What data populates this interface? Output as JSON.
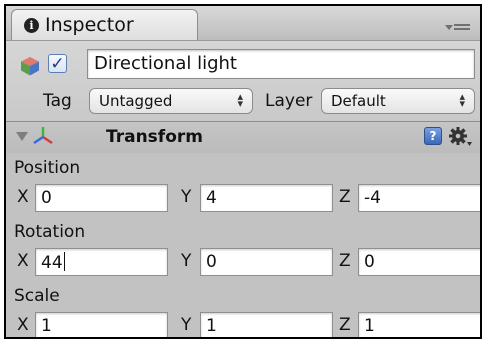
{
  "tab": {
    "title": "Inspector",
    "icon": "info-icon"
  },
  "object": {
    "active_checked": true,
    "name": "Directional light"
  },
  "tag": {
    "label": "Tag",
    "value": "Untagged"
  },
  "layer": {
    "label": "Layer",
    "value": "Default"
  },
  "component": {
    "title": "Transform",
    "expanded": true
  },
  "position": {
    "label": "Position",
    "x_label": "X",
    "x": "0",
    "y_label": "Y",
    "y": "4",
    "z_label": "Z",
    "z": "-4"
  },
  "rotation": {
    "label": "Rotation",
    "x_label": "X",
    "x": "44",
    "y_label": "Y",
    "y": "0",
    "z_label": "Z",
    "z": "0"
  },
  "scale": {
    "label": "Scale",
    "x_label": "X",
    "x": "1",
    "y_label": "Y",
    "y": "1",
    "z_label": "Z",
    "z": "1"
  },
  "colors": {
    "panel": "#c2c2c2",
    "header": "#d6d6d6",
    "field_bg": "#ffffff",
    "accent": "#3a67b8"
  }
}
